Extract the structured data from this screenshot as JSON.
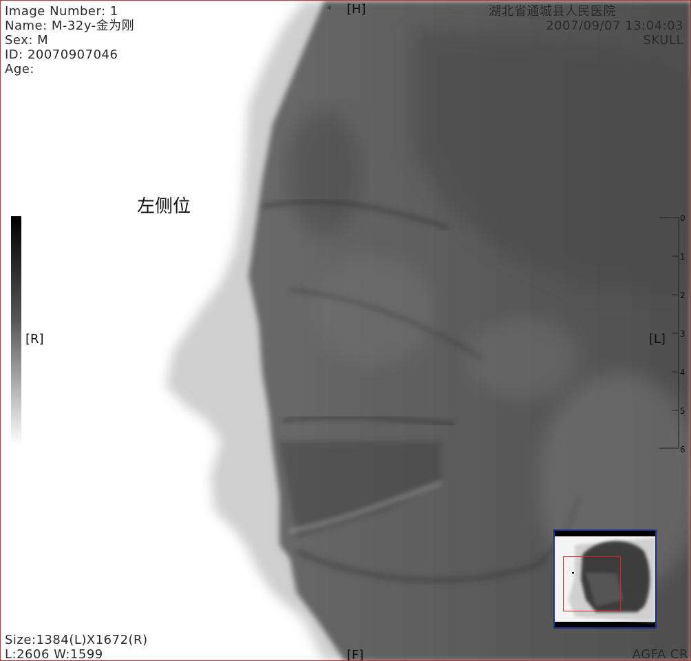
{
  "patient": {
    "image_number": "Image Number: 1",
    "name": "Name: M-32y-金为刚",
    "sex": "Sex: M",
    "id": "ID: 20070907046",
    "age": "Age:"
  },
  "study": {
    "hospital": "湖北省通城县人民医院",
    "datetime": "2007/09/07 13:04:03",
    "body_part": "SKULL"
  },
  "orientation": {
    "top": "[H]",
    "bottom": "[F]",
    "left": "[R]",
    "right": "[L]"
  },
  "view_label": "左侧位",
  "footer": {
    "size": "Size:1384(L)X1672(R)",
    "level_window": "L:2606  W:1599",
    "vendor": "AGFA CR"
  },
  "ruler": {
    "labels": [
      "0",
      "1",
      "2",
      "3",
      "4",
      "5",
      "6"
    ]
  },
  "icons": {
    "marker": "pin-marker-icon"
  },
  "colors": {
    "border": "#c23030",
    "roi": "#e02020",
    "thumbnail_frame": "#1c2f8f"
  }
}
